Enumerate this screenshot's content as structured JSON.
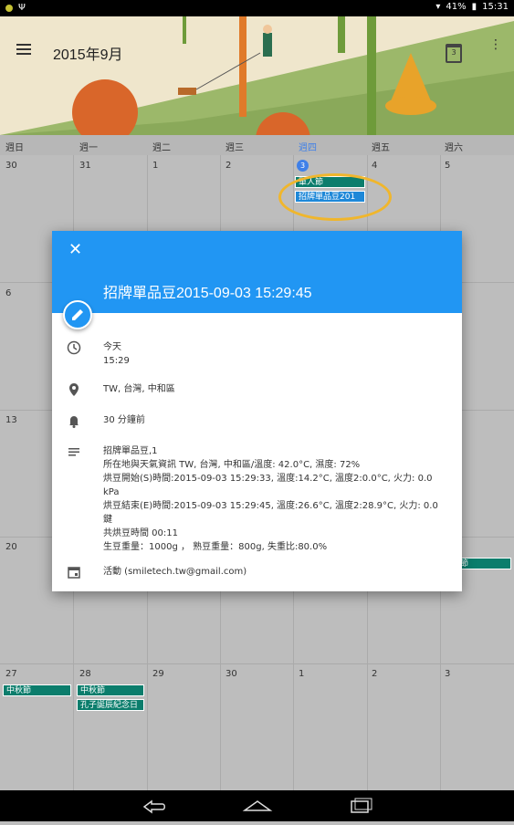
{
  "status_bar": {
    "battery": "41%",
    "time": "15:31"
  },
  "header": {
    "title": "2015年9月",
    "today_number": "3"
  },
  "weekdays": [
    "週日",
    "週一",
    "週二",
    "週三",
    "週四",
    "週五",
    "週六"
  ],
  "week1": [
    "30",
    "31",
    "1",
    "2",
    "3",
    "4",
    "5"
  ],
  "week2_first": "6",
  "week3_first": "13",
  "week4_first": "20",
  "week6": [
    "27",
    "28",
    "29",
    "30",
    "1",
    "2",
    "3"
  ],
  "events": {
    "thu_1": "軍人節",
    "thu_2": "招牌單品豆201",
    "sat_row4": "節",
    "sun_row6": "中秋節",
    "mon_row6_1": "中秋節",
    "mon_row6_2": "孔子誕辰紀念日"
  },
  "dialog": {
    "title": "招牌單品豆2015-09-03 15:29:45",
    "date": "今天",
    "time": "15:29",
    "location": "TW, 台灣, 中和區",
    "reminder": "30 分鐘前",
    "description": [
      "招牌單品豆,1",
      "所在地與天氣資訊 TW, 台灣, 中和區/溫度: 42.0°C, 濕度: 72%",
      "烘豆開始(S)時間:2015-09-03 15:29:33, 溫度:14.2°C, 溫度2:0.0°C, 火力: 0.0 kPa",
      "烘豆結束(E)時間:2015-09-03 15:29:45, 溫度:26.6°C, 溫度2:28.9°C, 火力: 0.0鍵",
      "共烘豆時間 00:11",
      "生豆重量：1000g ， 熟豆重量：800g, 失重比:80.0%"
    ],
    "calendar": "活動 (smiletech.tw@gmail.com)"
  },
  "colors": {
    "accent": "#2196f3",
    "event": "#0b7d6c",
    "highlight": "#f0b62c"
  }
}
